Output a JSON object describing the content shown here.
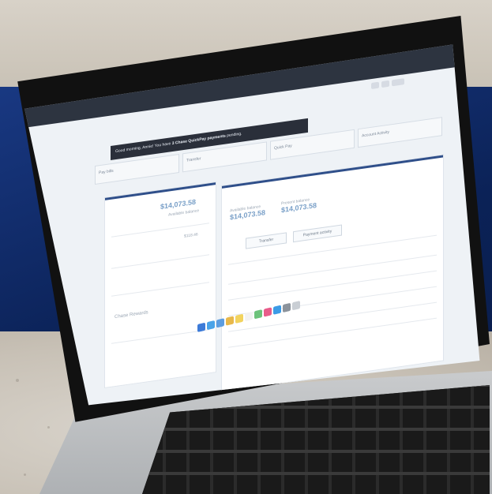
{
  "photo": {
    "subject": "",
    "app": {
      "banner_prefix": "Good morning, Annie! You have ",
      "banner_emph": "3 Chase QuickPay payments",
      "banner_suffix": " pending.",
      "tabs": [
        "Pay bills",
        "Transfer",
        "Quick Pay",
        "Account Activity"
      ],
      "left_amount": "$14,073.58",
      "left_label": "Available balance",
      "right_amount_1": "$14,073.58",
      "right_amount_2": "$14,073.58",
      "right_label_1": "Available balance",
      "right_label_2": "Present balance",
      "button_1": "Transfer",
      "button_2": "Payment activity",
      "left_prompt": "Chase Rewards",
      "left_value": "$118.46"
    },
    "colors": {
      "accent": "#2f4f8a",
      "amount": "#7aa0c8",
      "page_bg": "#0f2a66"
    },
    "dock_icons": [
      "finder-icon",
      "safari-icon",
      "mail-icon",
      "photos-icon",
      "notes-icon",
      "calendar-icon",
      "maps-icon",
      "music-icon",
      "store-icon",
      "settings-icon",
      "trash-icon"
    ]
  }
}
